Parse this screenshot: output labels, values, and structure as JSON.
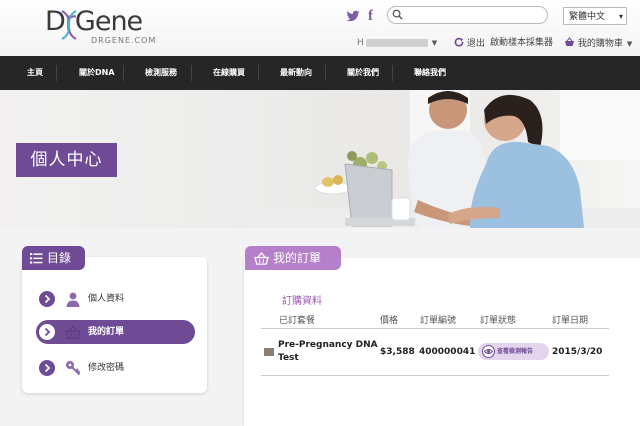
{
  "brand": {
    "logo_main": "DrGene",
    "logo_prefix": "D",
    "logo_r": "r",
    "logo_rest": "Gene",
    "logo_sub": "DRGENE.COM"
  },
  "header": {
    "search_placeholder": "",
    "language": "繁體中文",
    "user_initial": "H",
    "logout": "退出",
    "activate_kit": "啟動樣本採集器",
    "cart": "我的購物車"
  },
  "nav": {
    "items": [
      "主頁",
      "關於DNA",
      "檢測服務",
      "在線購買",
      "最新動向",
      "關於我們",
      "聯絡我們"
    ]
  },
  "banner": {
    "title": "個人中心"
  },
  "sidebar": {
    "title": "目錄",
    "items": [
      {
        "label": "個人資料",
        "icon": "person-icon",
        "active": false
      },
      {
        "label": "我的訂單",
        "icon": "basket-icon",
        "active": true
      },
      {
        "label": "修改密碼",
        "icon": "key-icon",
        "active": false
      }
    ]
  },
  "orders": {
    "title": "我的訂單",
    "section_title": "訂購資料",
    "columns": [
      "已訂套餐",
      "價格",
      "訂單編號",
      "訂單狀態",
      "訂單日期"
    ],
    "rows": [
      {
        "package": "Pre-Pregnancy DNA Test",
        "price": "$3,588",
        "order_no": "400000041",
        "status_button": "查看檢測報告",
        "date": "2015/3/20"
      }
    ]
  },
  "colors": {
    "primary_purple": "#6f4b95",
    "light_purple": "#b57fc9",
    "nav_bg": "#262626"
  }
}
